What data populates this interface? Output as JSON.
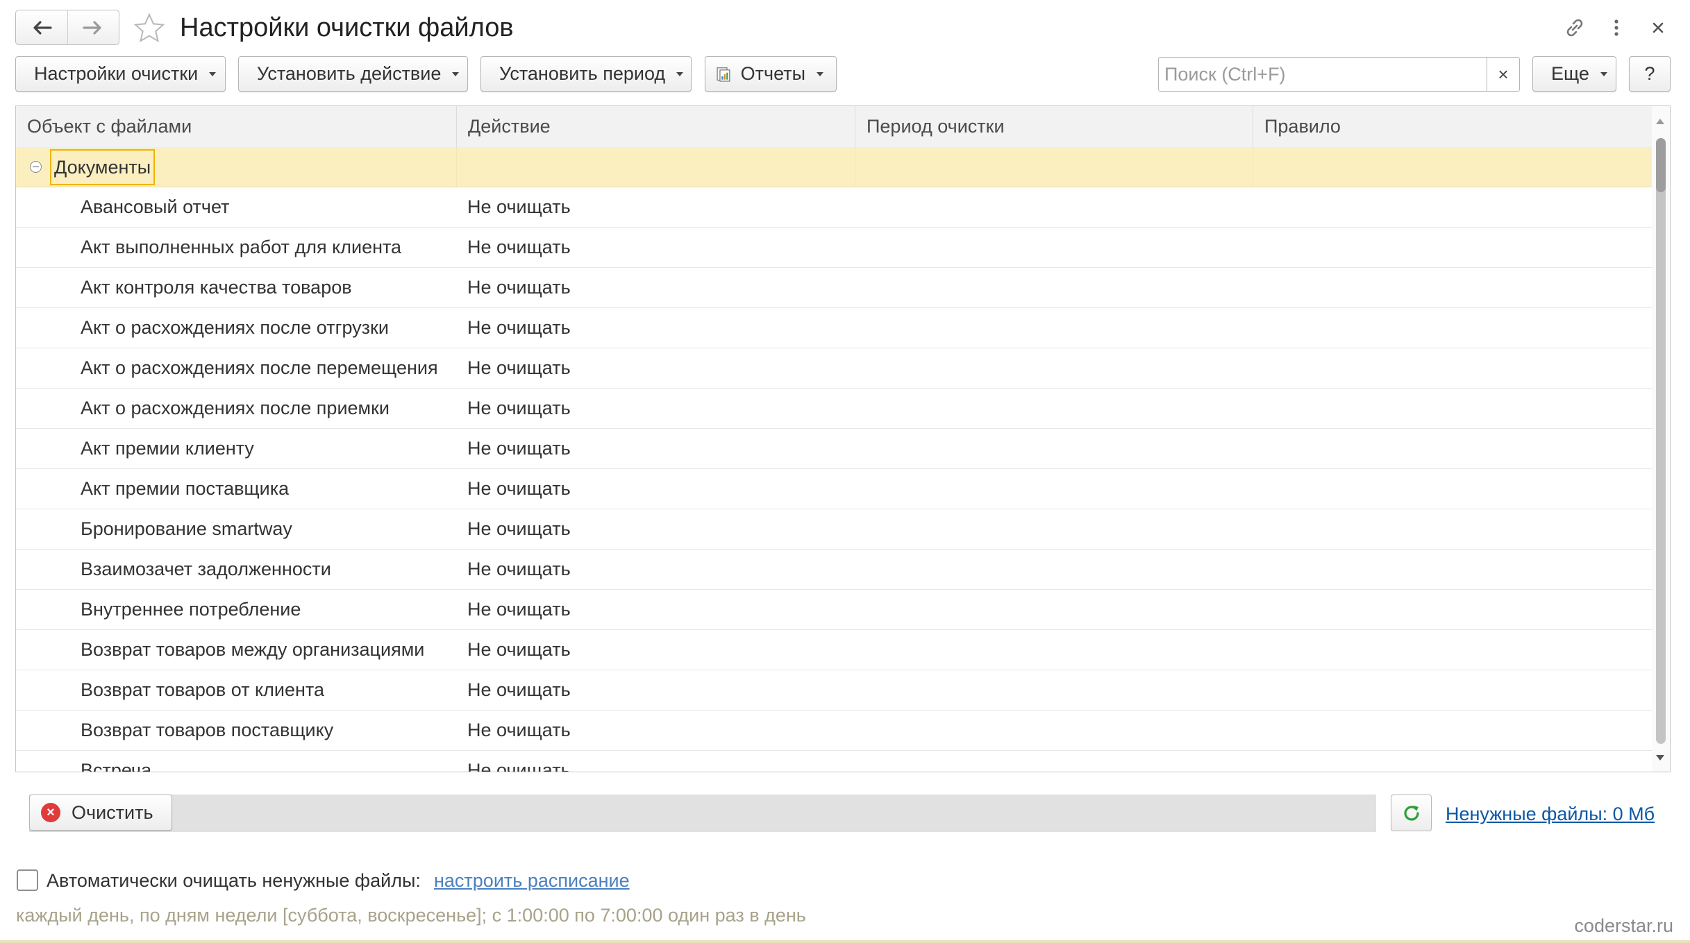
{
  "window": {
    "title": "Настройки очистки файлов"
  },
  "toolbar": {
    "settings_label": "Настройки очистки",
    "set_action_label": "Установить действие",
    "set_period_label": "Установить период",
    "reports_label": "Отчеты",
    "search_placeholder": "Поиск (Ctrl+F)",
    "search_clear": "×",
    "more_label": "Еще",
    "help_label": "?"
  },
  "table": {
    "columns": [
      "Объект с файлами",
      "Действие",
      "Период очистки",
      "Правило"
    ],
    "group": "Документы",
    "rows": [
      {
        "object": "Авансовый отчет",
        "action": "Не очищать"
      },
      {
        "object": "Акт выполненных работ для клиента",
        "action": "Не очищать"
      },
      {
        "object": "Акт контроля качества товаров",
        "action": "Не очищать"
      },
      {
        "object": "Акт о расхождениях после отгрузки",
        "action": "Не очищать"
      },
      {
        "object": "Акт о расхождениях после перемещения",
        "action": "Не очищать"
      },
      {
        "object": "Акт о расхождениях после приемки",
        "action": "Не очищать"
      },
      {
        "object": "Акт премии клиенту",
        "action": "Не очищать"
      },
      {
        "object": "Акт премии поставщика",
        "action": "Не очищать"
      },
      {
        "object": "Бронирование smartway",
        "action": "Не очищать"
      },
      {
        "object": "Взаимозачет задолженности",
        "action": "Не очищать"
      },
      {
        "object": "Внутреннее потребление",
        "action": "Не очищать"
      },
      {
        "object": "Возврат товаров между организациями",
        "action": "Не очищать"
      },
      {
        "object": "Возврат товаров от клиента",
        "action": "Не очищать"
      },
      {
        "object": "Возврат товаров поставщику",
        "action": "Не очищать"
      },
      {
        "object": "Встреча",
        "action": "Не очищать"
      }
    ]
  },
  "cleanup": {
    "clear_label": "Очистить",
    "unneeded_files_link": "Ненужные файлы: 0 Мб"
  },
  "auto": {
    "checkbox_checked": false,
    "label": "Автоматически очищать ненужные файлы:",
    "schedule_link": "настроить расписание",
    "schedule_text": "каждый день, по дням недели [суббота, воскресенье]; с 1:00:00 по 7:00:00 один раз в день"
  },
  "watermark": "coderstar.ru",
  "colors": {
    "group_row_bg": "#fbefc0",
    "group_focus_border": "#f0b400",
    "link": "#0b57a4",
    "clear_icon": "#e13a3a",
    "refresh_icon": "#2e9e3a"
  }
}
